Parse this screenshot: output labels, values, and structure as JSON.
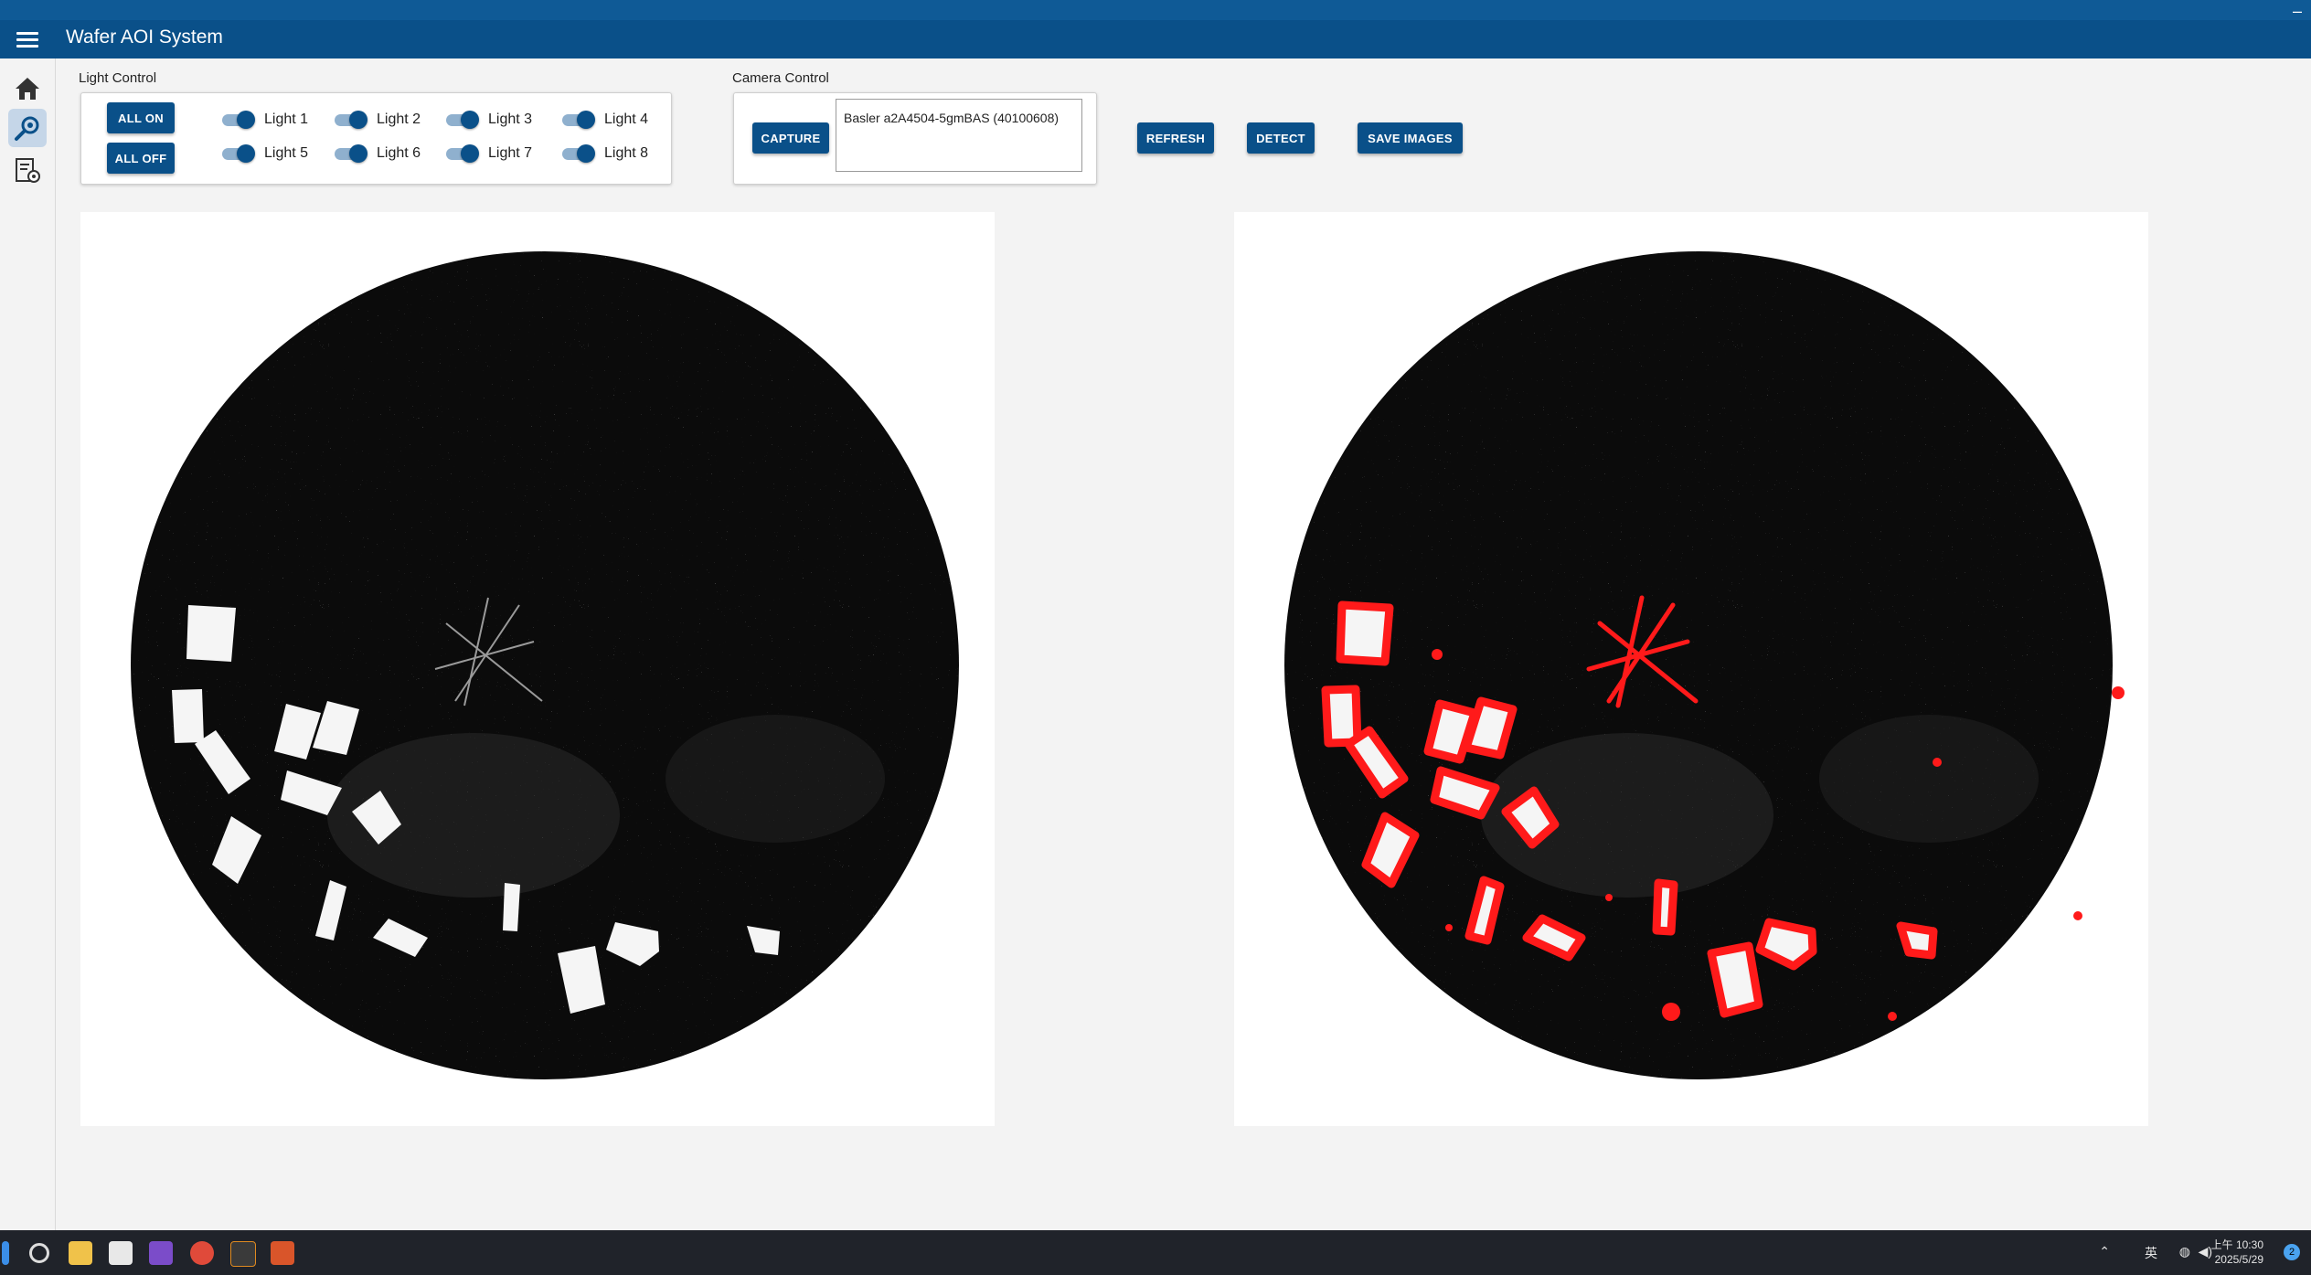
{
  "app": {
    "title": "Wafer AOI System"
  },
  "nav": [
    {
      "name": "home-icon"
    },
    {
      "name": "inspection-icon",
      "active": true
    },
    {
      "name": "recipe-settings-icon"
    }
  ],
  "light_control": {
    "label": "Light Control",
    "all_on": "ALL ON",
    "all_off": "ALL OFF",
    "lights": [
      {
        "label": "Light 1",
        "on": true
      },
      {
        "label": "Light 2",
        "on": true
      },
      {
        "label": "Light 3",
        "on": true
      },
      {
        "label": "Light 4",
        "on": true
      },
      {
        "label": "Light 5",
        "on": true
      },
      {
        "label": "Light 6",
        "on": true
      },
      {
        "label": "Light 7",
        "on": true
      },
      {
        "label": "Light 8",
        "on": true
      }
    ]
  },
  "camera_control": {
    "label": "Camera Control",
    "capture": "CAPTURE",
    "camera_name": "Basler a2A4504-5gmBAS (40100608)"
  },
  "actions": {
    "refresh": "REFRESH",
    "detect": "DETECT",
    "save_images": "SAVE IMAGES"
  },
  "taskbar": {
    "ime": "英",
    "clock_time": "上午 10:30",
    "clock_date": "2025/5/29",
    "notifications": "2"
  },
  "colors": {
    "primary": "#0a5089",
    "defect_outline": "#ff1a1a"
  }
}
